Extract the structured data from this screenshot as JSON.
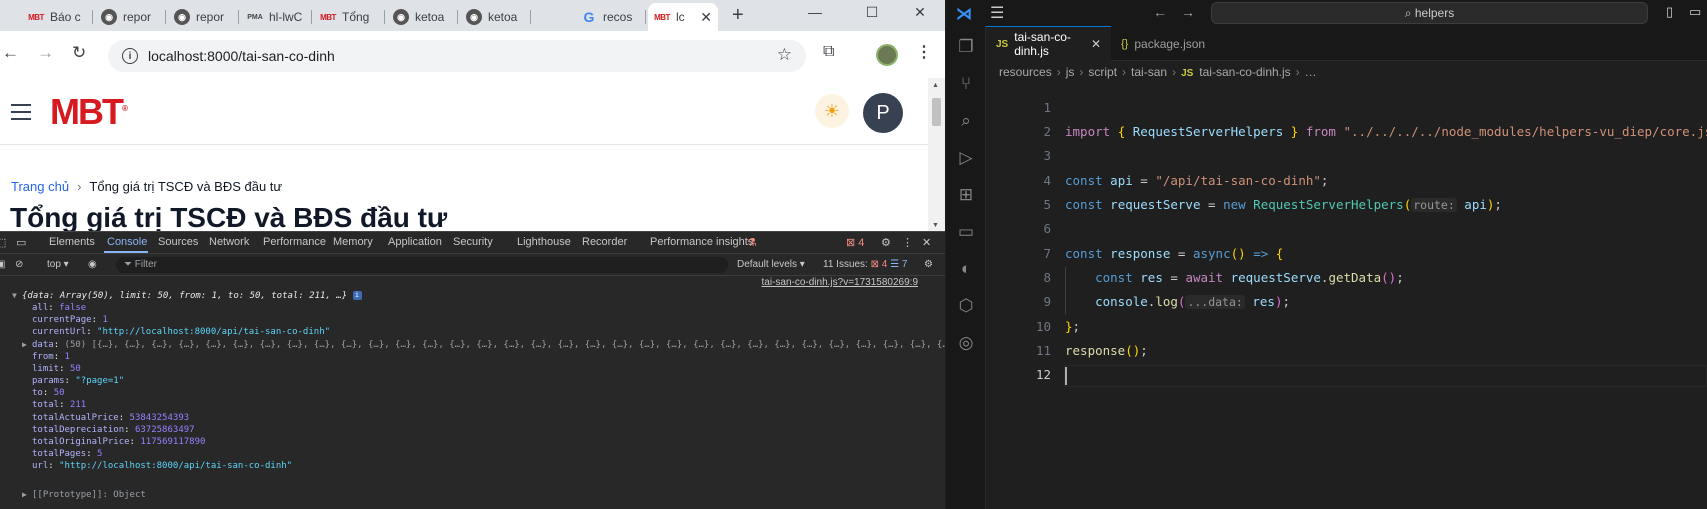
{
  "browser": {
    "tabs": [
      {
        "label": "Báo c",
        "icon": "mbt-favicon"
      },
      {
        "label": "repor",
        "icon": "globe-favicon"
      },
      {
        "label": "repor",
        "icon": "globe-favicon"
      },
      {
        "label": "hl-lwC",
        "icon": "pma-favicon"
      },
      {
        "label": "Tổng",
        "icon": "mbt-favicon"
      },
      {
        "label": "ketoa",
        "icon": "globe-favicon"
      },
      {
        "label": "ketoa",
        "icon": "globe-favicon"
      },
      {
        "label": "recos",
        "icon": "google-favicon"
      },
      {
        "label": "lc",
        "icon": "mbt-favicon"
      }
    ],
    "favicon_mbt_text": "MBT",
    "favicon_pma_text": "PMA",
    "favicon_google_text": "G",
    "url": "localhost:8000/tai-san-co-dinh"
  },
  "site": {
    "logo": "MBT",
    "logo_mark": "®",
    "avatar_letter": "P",
    "breadcrumb_home": "Trang chủ",
    "breadcrumb_current": "Tổng giá trị TSCĐ và BĐS đầu tư",
    "page_title": "Tổng giá trị TSCĐ và BĐS đầu tư"
  },
  "devtools": {
    "tabs": [
      "Elements",
      "Console",
      "Sources",
      "Network",
      "Performance",
      "Memory",
      "Application",
      "Security",
      "Lighthouse",
      "Recorder",
      "Performance insights"
    ],
    "active_tab": "Console",
    "error_badge": "4",
    "context": "top",
    "filter_placeholder": "Filter",
    "levels": "Default levels",
    "issues_label": "11 Issues:",
    "issues_errors": "4",
    "issues_info": "7",
    "source_link": "tai-san-co-dinh.js?v=1731580269:9",
    "summary": "{data: Array(50), limit: 50, from: 1, to: 50, total: 211, …}",
    "entries": [
      {
        "key": "all",
        "value": "false",
        "type": "kw"
      },
      {
        "key": "currentPage",
        "value": "1",
        "type": "num"
      },
      {
        "key": "currentUrl",
        "value": "\"http://localhost:8000/api/tai-san-co-dinh\"",
        "type": "str"
      },
      {
        "key": "data",
        "value": "(50) [{…}, {…}, {…}, {…}, {…}, {…}, {…}, {…}, {…}, {…}, {…}, {…}, {…}, {…}, {…}, {…}, {…}, {…}, {…}, {…}, {…}, {…}, {…}, {…}, {…}, {…}, {…}, {…}, {…}, {…}, {…}, {…}, {…}, {…}, {…}, {…}, {…}, {…}, {…}, {…}",
        "type": "plain"
      },
      {
        "key": "from",
        "value": "1",
        "type": "num"
      },
      {
        "key": "limit",
        "value": "50",
        "type": "num"
      },
      {
        "key": "params",
        "value": "\"?page=1\"",
        "type": "str"
      },
      {
        "key": "to",
        "value": "50",
        "type": "num"
      },
      {
        "key": "total",
        "value": "211",
        "type": "num"
      },
      {
        "key": "totalActualPrice",
        "value": "53843254393",
        "type": "num"
      },
      {
        "key": "totalDepreciation",
        "value": "63725863497",
        "type": "num"
      },
      {
        "key": "totalOriginalPrice",
        "value": "117569117890",
        "type": "num"
      },
      {
        "key": "totalPages",
        "value": "5",
        "type": "num"
      },
      {
        "key": "url",
        "value": "\"http://localhost:8000/api/tai-san-co-dinh\"",
        "type": "str"
      }
    ],
    "prototype": "[[Prototype]]: Object"
  },
  "vscode": {
    "search": "helpers",
    "tabs": [
      {
        "label": "tai-san-co-dinh.js",
        "icon": "JS",
        "active": true
      },
      {
        "label": "package.json",
        "icon": "{}",
        "active": false
      }
    ],
    "breadcrumb": [
      "resources",
      "js",
      "script",
      "tai-san",
      "tai-san-co-dinh.js",
      "…"
    ],
    "line_numbers": [
      "1",
      "2",
      "3",
      "4",
      "5",
      "6",
      "7",
      "8",
      "9",
      "10",
      "11",
      "12"
    ],
    "code": {
      "import_path": "\"../../../../node_modules/helpers-vu_diep/core.js\"",
      "api_value": "\"/api/tai-san-co-dinh\"",
      "class_name": "RequestServerHelpers",
      "hint_route": "route:",
      "hint_data": "...data:"
    }
  },
  "colors": {
    "vscode_bg": "#1f1f1f",
    "devtools_bg": "#282828",
    "brand_red": "#d71920",
    "accent_blue": "#8ab4f8"
  }
}
